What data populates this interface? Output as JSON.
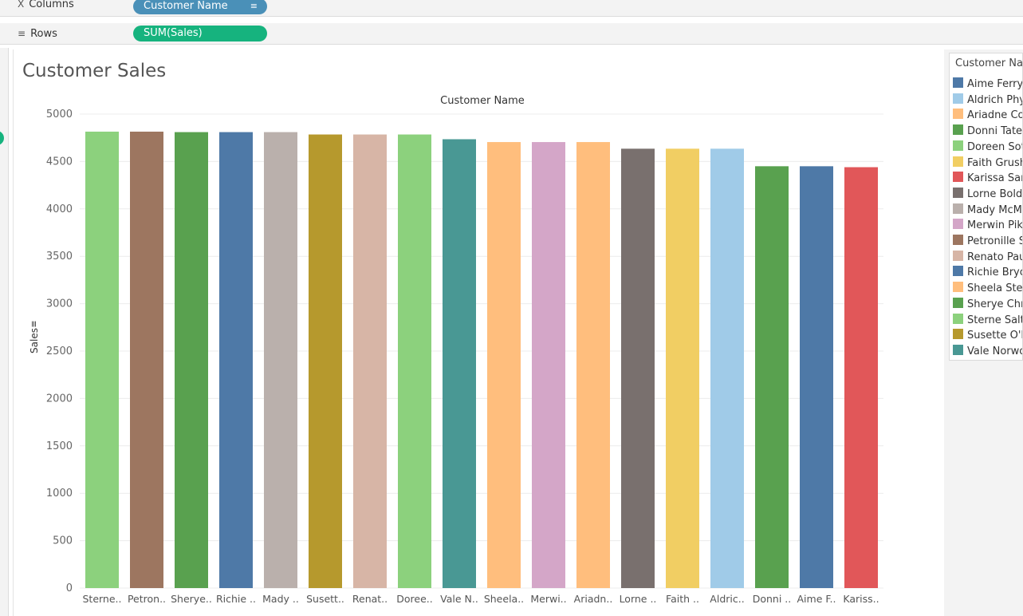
{
  "shelves": {
    "columns": {
      "label": "Columns",
      "pill": "Customer Name"
    },
    "rows": {
      "label": "Rows",
      "pill": "SUM(Sales)"
    }
  },
  "sheet_title": "Customer Sales",
  "legend": {
    "title": "Customer Na",
    "items": [
      {
        "label": "Aime Ferry",
        "color": "#4e79a7"
      },
      {
        "label": "Aldrich Phy",
        "color": "#a0cbe8"
      },
      {
        "label": "Ariadne Co",
        "color": "#ffbe7d"
      },
      {
        "label": "Donni Tate",
        "color": "#59a14f"
      },
      {
        "label": "Doreen Sot",
        "color": "#8cd17d"
      },
      {
        "label": "Faith Grush",
        "color": "#f1ce63"
      },
      {
        "label": "Karissa Sar",
        "color": "#e15759"
      },
      {
        "label": "Lorne Bold",
        "color": "#79706e"
      },
      {
        "label": "Mady McM",
        "color": "#bab0ac"
      },
      {
        "label": "Merwin Pik",
        "color": "#d4a6c8"
      },
      {
        "label": "Petronille S",
        "color": "#9d7660"
      },
      {
        "label": "Renato Pau",
        "color": "#d7b5a6"
      },
      {
        "label": "Richie Bryc",
        "color": "#4e79a7"
      },
      {
        "label": "Sheela Stei",
        "color": "#ffbe7d"
      },
      {
        "label": "Sherye Chr",
        "color": "#59a14f"
      },
      {
        "label": "Sterne Salt",
        "color": "#8cd17d"
      },
      {
        "label": "Susette O'I",
        "color": "#b6992d"
      },
      {
        "label": "Vale Norwo",
        "color": "#499894"
      }
    ]
  },
  "chart_data": {
    "type": "bar",
    "title": "Customer Name",
    "xlabel": "",
    "ylabel": "Sales",
    "ylim": [
      0,
      5000
    ],
    "yticks": [
      0,
      500,
      1000,
      1500,
      2000,
      2500,
      3000,
      3500,
      4000,
      4500,
      5000
    ],
    "grid": true,
    "categories": [
      "Sterne..",
      "Petron..",
      "Sherye..",
      "Richie ..",
      "Mady ..",
      "Susett..",
      "Renat..",
      "Doree..",
      "Vale N..",
      "Sheela..",
      "Merwi..",
      "Ariadn..",
      "Lorne ..",
      "Faith ..",
      "Aldric..",
      "Donni ..",
      "Aime F..",
      "Kariss.."
    ],
    "values": [
      4815,
      4815,
      4810,
      4810,
      4810,
      4785,
      4785,
      4785,
      4735,
      4705,
      4705,
      4705,
      4635,
      4635,
      4635,
      4450,
      4450,
      4440
    ],
    "colors": [
      "#8cd17d",
      "#9d7660",
      "#59a14f",
      "#4e79a7",
      "#bab0ac",
      "#b6992d",
      "#d7b5a6",
      "#8cd17d",
      "#499894",
      "#ffbe7d",
      "#d4a6c8",
      "#ffbe7d",
      "#79706e",
      "#f1ce63",
      "#a0cbe8",
      "#59a14f",
      "#4e79a7",
      "#e15759"
    ]
  }
}
